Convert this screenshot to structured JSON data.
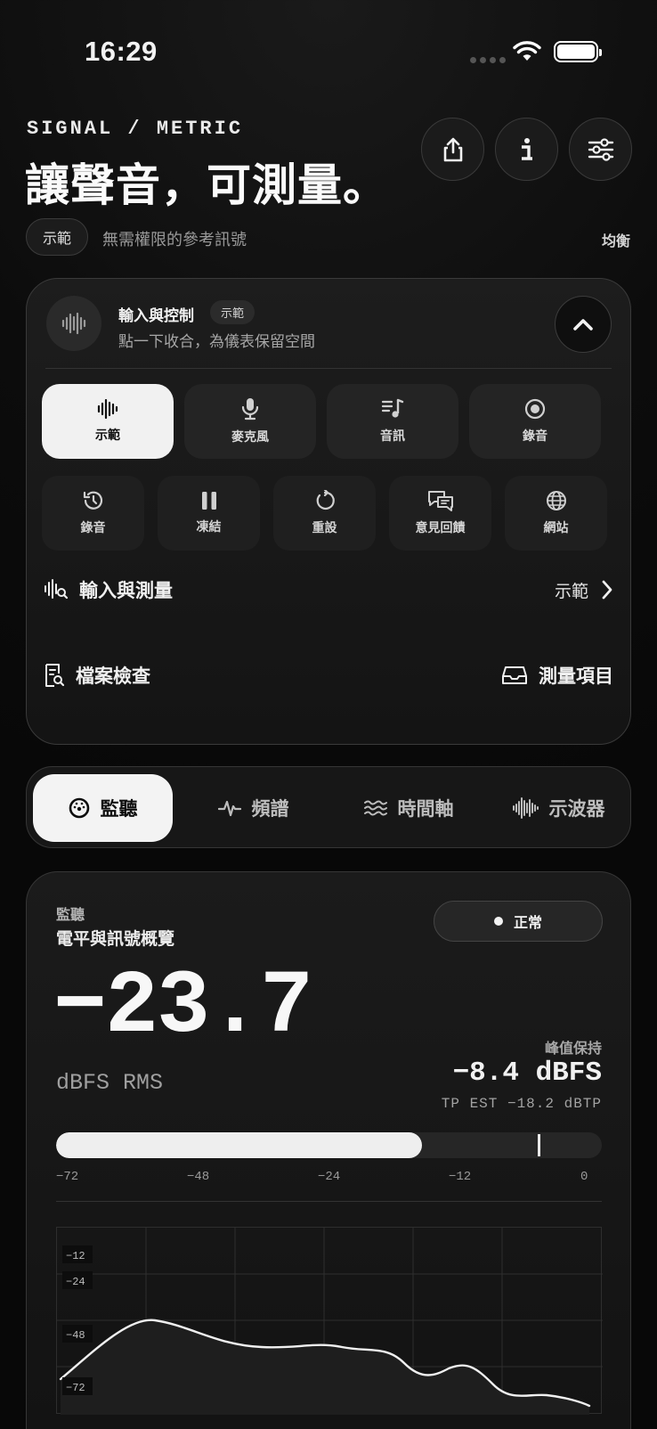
{
  "status_bar": {
    "time": "16:29"
  },
  "header": {
    "kicker": "SIGNAL / METRIC",
    "title": "讓聲音，可測量。",
    "chip": "示範",
    "note": "無需權限的參考訊號",
    "balance": "均衡"
  },
  "control_card": {
    "title": "輸入與控制",
    "tag": "示範",
    "subtitle": "點一下收合，為儀表保留空間",
    "modes": [
      {
        "label": "示範",
        "icon": "waveform-icon",
        "active": true
      },
      {
        "label": "麥克風",
        "icon": "microphone-icon",
        "active": false
      },
      {
        "label": "音訊",
        "icon": "music-list-icon",
        "active": false
      },
      {
        "label": "錄音",
        "icon": "record-icon",
        "active": false
      }
    ],
    "actions": [
      {
        "label": "錄音",
        "icon": "history-icon"
      },
      {
        "label": "凍結",
        "icon": "pause-icon"
      },
      {
        "label": "重設",
        "icon": "reset-icon"
      },
      {
        "label": "意見回饋",
        "icon": "feedback-icon"
      },
      {
        "label": "網站",
        "icon": "globe-icon"
      }
    ],
    "input_row": {
      "label": "輸入與測量",
      "value": "示範"
    },
    "file_check": "檔案檢查",
    "measure_items": "測量項目"
  },
  "tabs": [
    {
      "label": "監聽",
      "icon": "gauge-icon",
      "active": true
    },
    {
      "label": "頻譜",
      "icon": "pulse-icon",
      "active": false
    },
    {
      "label": "時間軸",
      "icon": "waves-icon",
      "active": false
    },
    {
      "label": "示波器",
      "icon": "oscilloscope-icon",
      "active": false
    }
  ],
  "monitor": {
    "kicker": "監聽",
    "title": "電平與訊號概覽",
    "status": "正常",
    "rms_value": "−23.7",
    "rms_unit": "dBFS RMS",
    "peak_label": "峰值保持",
    "peak_value": "−8.4 dBFS",
    "tp_est": "TP EST −18.2 dBTP",
    "meter_level_dbfs": -23.7,
    "meter_peak_dbfs": -8.4,
    "scale": [
      "−72",
      "−48",
      "−24",
      "−12",
      "0"
    ],
    "graph_labels": [
      "−12",
      "−24",
      "−48",
      "−72"
    ]
  },
  "colors": {
    "accent": "#f2f2f2",
    "background": "#0c0c0c",
    "panel": "#1b1b1b"
  }
}
